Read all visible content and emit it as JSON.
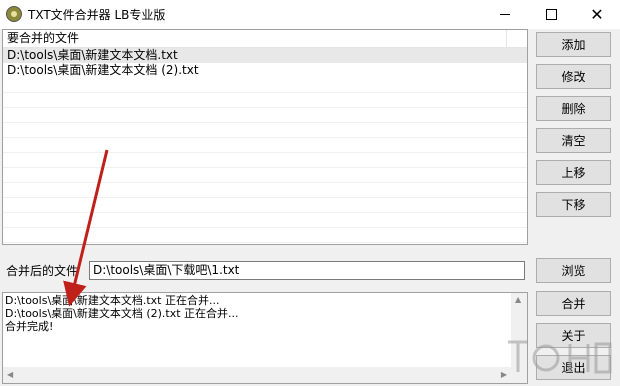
{
  "window": {
    "title": "TXT文件合并器 LB专业版",
    "minimize_icon": "minimize-icon",
    "maximize_icon": "maximize-icon",
    "close_glyph": "✕"
  },
  "file_list": {
    "column_header": "要合并的文件",
    "rows": [
      "D:\\tools\\桌面\\新建文本文档.txt",
      "D:\\tools\\桌面\\新建文本文档 (2).txt"
    ]
  },
  "buttons": {
    "add": "添加",
    "modify": "修改",
    "delete": "删除",
    "clear": "清空",
    "move_up": "上移",
    "move_down": "下移",
    "browse": "浏览",
    "merge": "合并",
    "about": "关于",
    "exit": "退出"
  },
  "output": {
    "label": "合并后的文件",
    "value": "D:\\tools\\桌面\\下载吧\\1.txt"
  },
  "log": {
    "lines": [
      "D:\\tools\\桌面\\新建文本文档.txt 正在合并...",
      "D:\\tools\\桌面\\新建文本文档 (2).txt 正在合并...",
      "合并完成!"
    ]
  },
  "colors": {
    "annotation_arrow": "#c0201a"
  }
}
